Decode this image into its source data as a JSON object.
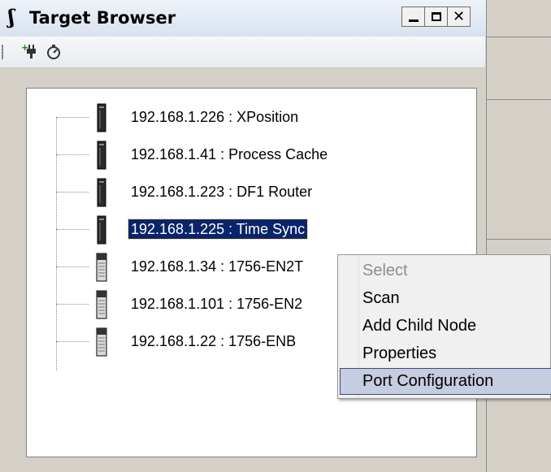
{
  "window": {
    "title": "Target Browser",
    "icon": "s-app-icon"
  },
  "toolbar": {
    "icons": [
      "add-connection-icon",
      "refresh-scan-icon"
    ]
  },
  "tree": {
    "items": [
      {
        "label": "192.168.1.226 : XPosition",
        "device": "slim-module"
      },
      {
        "label": "192.168.1.41 : Process Cache",
        "device": "slim-module"
      },
      {
        "label": "192.168.1.223 : DF1 Router",
        "device": "slim-module"
      },
      {
        "label": "192.168.1.225 : Time Sync",
        "device": "slim-module",
        "selected": true
      },
      {
        "label": "192.168.1.34 : 1756-EN2T",
        "device": "wide-module"
      },
      {
        "label": "192.168.1.101 : 1756-EN2",
        "device": "wide-module"
      },
      {
        "label": "192.168.1.22 : 1756-ENB",
        "device": "wide-module"
      }
    ]
  },
  "context_menu": {
    "items": [
      {
        "label": "Select",
        "disabled": true
      },
      {
        "label": "Scan"
      },
      {
        "label": "Add Child Node"
      },
      {
        "label": "Properties"
      },
      {
        "label": "Port Configuration",
        "highlighted": true
      }
    ]
  },
  "colors": {
    "selection": "#0a246a",
    "menu_highlight": "#c6cde1"
  }
}
